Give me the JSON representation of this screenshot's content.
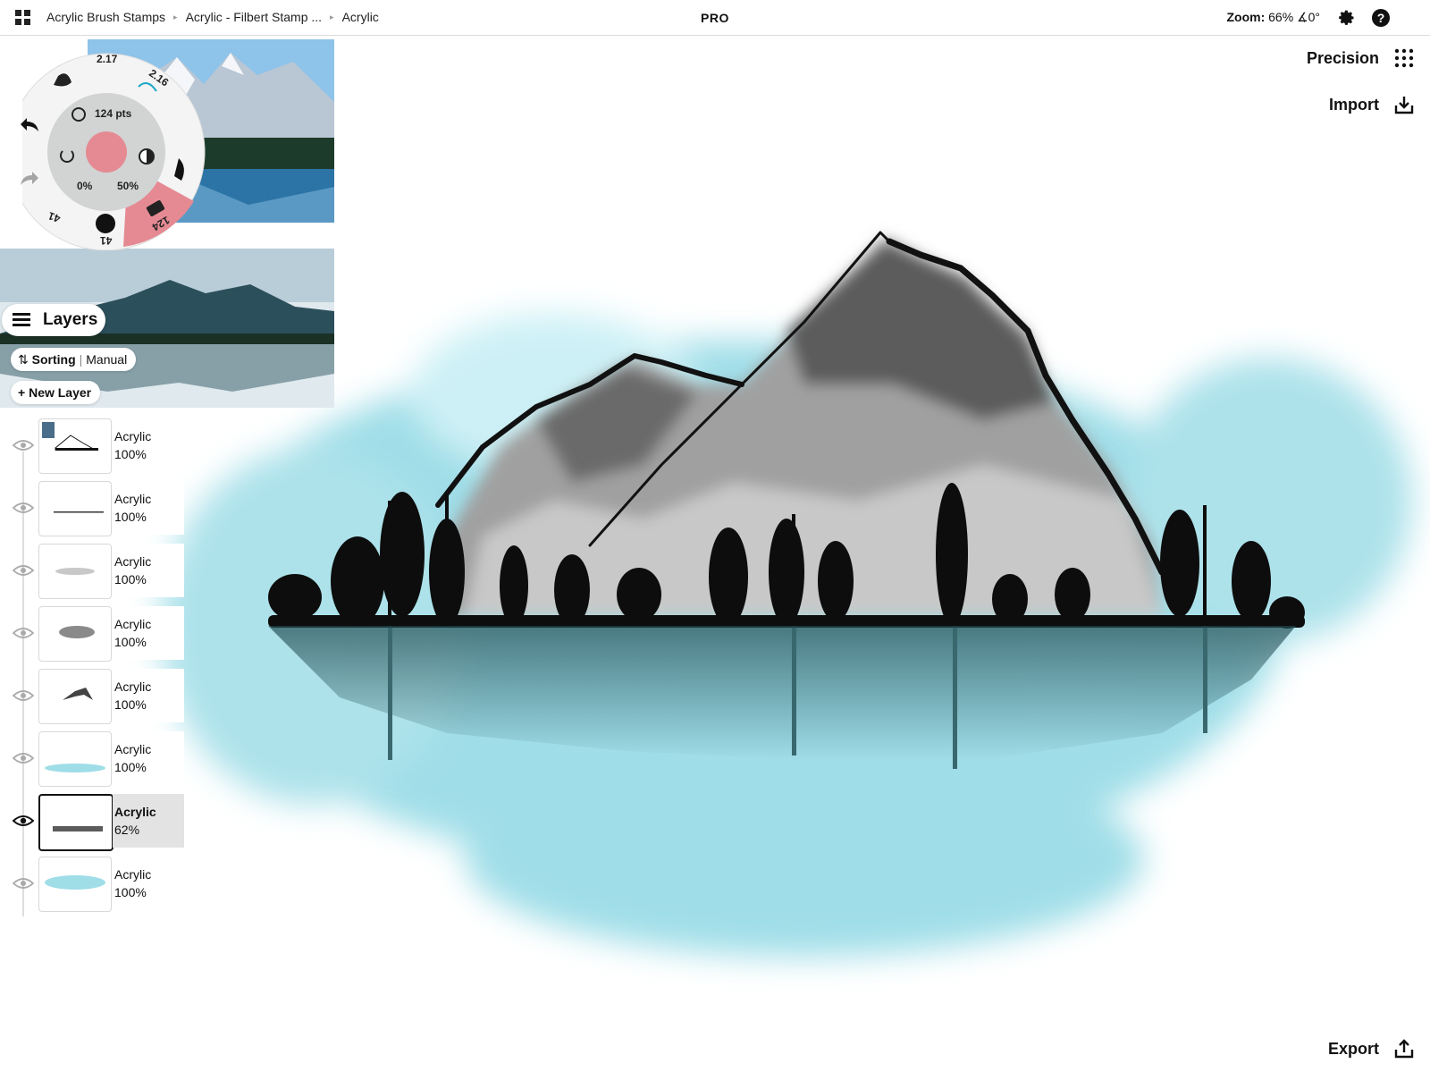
{
  "topbar": {
    "breadcrumbs": [
      "Acrylic Brush Stamps",
      "Acrylic - Filbert Stamp ...",
      "Acrylic"
    ],
    "pro_label": "PRO",
    "zoom_label": "Zoom:",
    "zoom_value": "66%",
    "rotation_value": "∡0°"
  },
  "tool_wheel": {
    "size_label": "124 pts",
    "opacity_left": "0%",
    "opacity_right": "50%",
    "preset_top_left": "2.17",
    "preset_top_right": "2.16",
    "preset_bottom_left": "41",
    "preset_bottom_middle": "41",
    "preset_bottom_active": "124",
    "color": "#e58a93"
  },
  "layers_panel": {
    "title": "Layers",
    "sorting_label": "Sorting",
    "sorting_value": "Manual",
    "new_layer_label": "New Layer",
    "layers": [
      {
        "name": "Acrylic",
        "opacity": "100%"
      },
      {
        "name": "Acrylic",
        "opacity": "100%"
      },
      {
        "name": "Acrylic",
        "opacity": "100%"
      },
      {
        "name": "Acrylic",
        "opacity": "100%"
      },
      {
        "name": "Acrylic",
        "opacity": "100%"
      },
      {
        "name": "Acrylic",
        "opacity": "100%"
      },
      {
        "name": "Acrylic",
        "opacity": "62%"
      },
      {
        "name": "Acrylic",
        "opacity": "100%"
      }
    ]
  },
  "right_actions": {
    "precision_label": "Precision",
    "import_label": "Import",
    "export_label": "Export"
  },
  "colors": {
    "accent_pink": "#e58a93",
    "water_cyan": "#8fd8e4",
    "ink": "#111111"
  }
}
